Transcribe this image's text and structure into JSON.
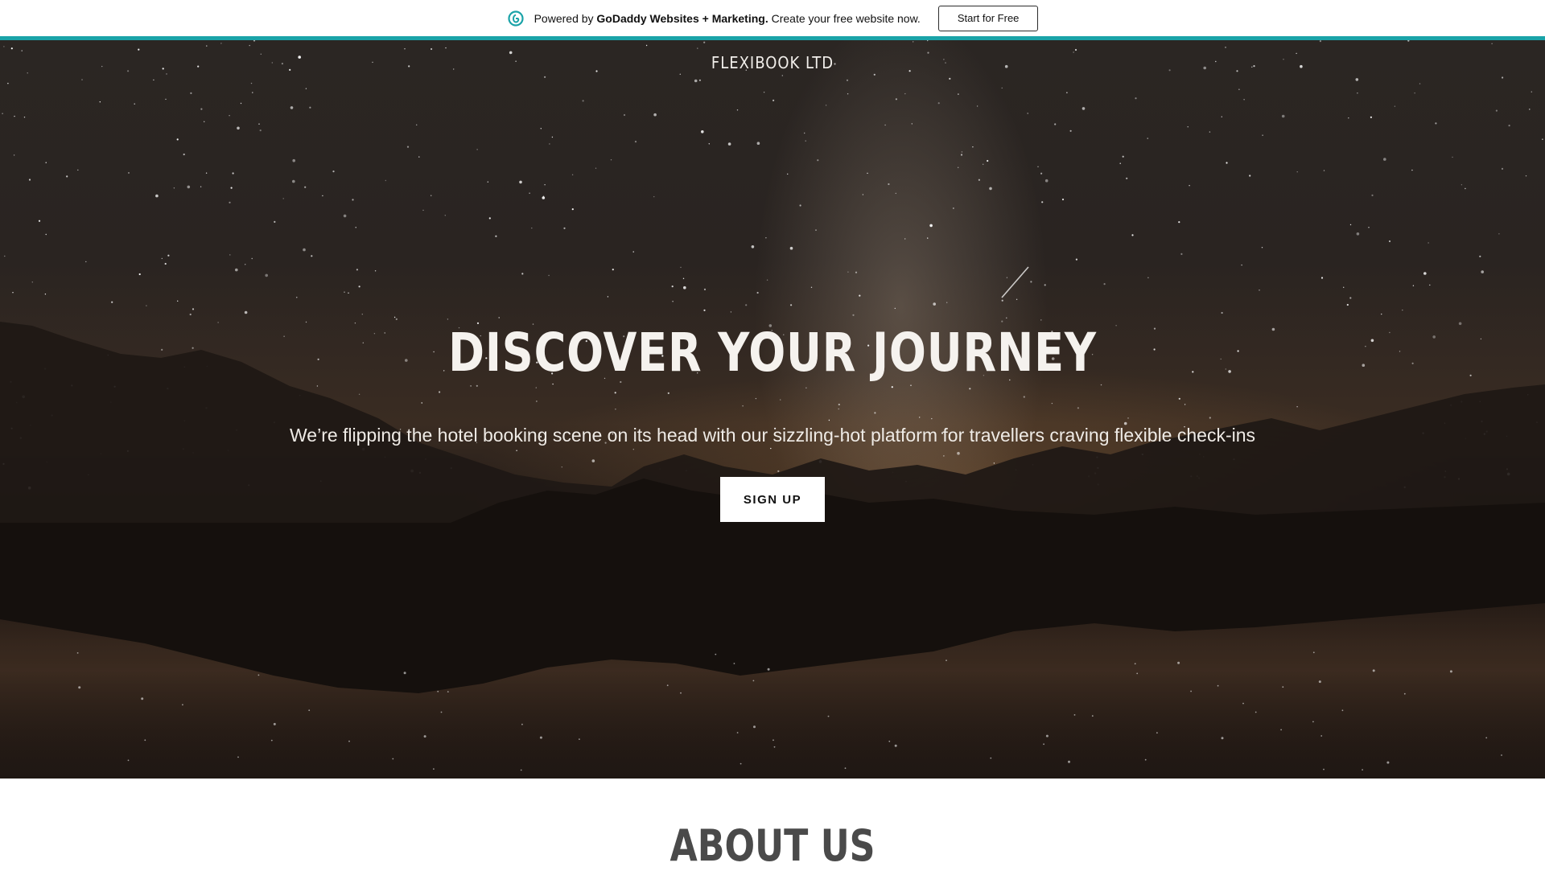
{
  "promo_bar": {
    "prefix": "Powered by ",
    "brand": "GoDaddy Websites + Marketing.",
    "suffix": " Create your free website now.",
    "cta_label": "Start for Free",
    "logo_icon": "godaddy-logo-icon",
    "accent_color": "#1aa3a8"
  },
  "hero": {
    "site_name": "FLEXIBOOK LTD",
    "title": "DISCOVER YOUR JOURNEY",
    "subtitle": "We’re flipping the hotel booking scene on its head with our sizzling-hot platform for travellers craving flexible check-ins",
    "cta_label": "SIGN UP"
  },
  "about": {
    "title": "ABOUT US"
  }
}
